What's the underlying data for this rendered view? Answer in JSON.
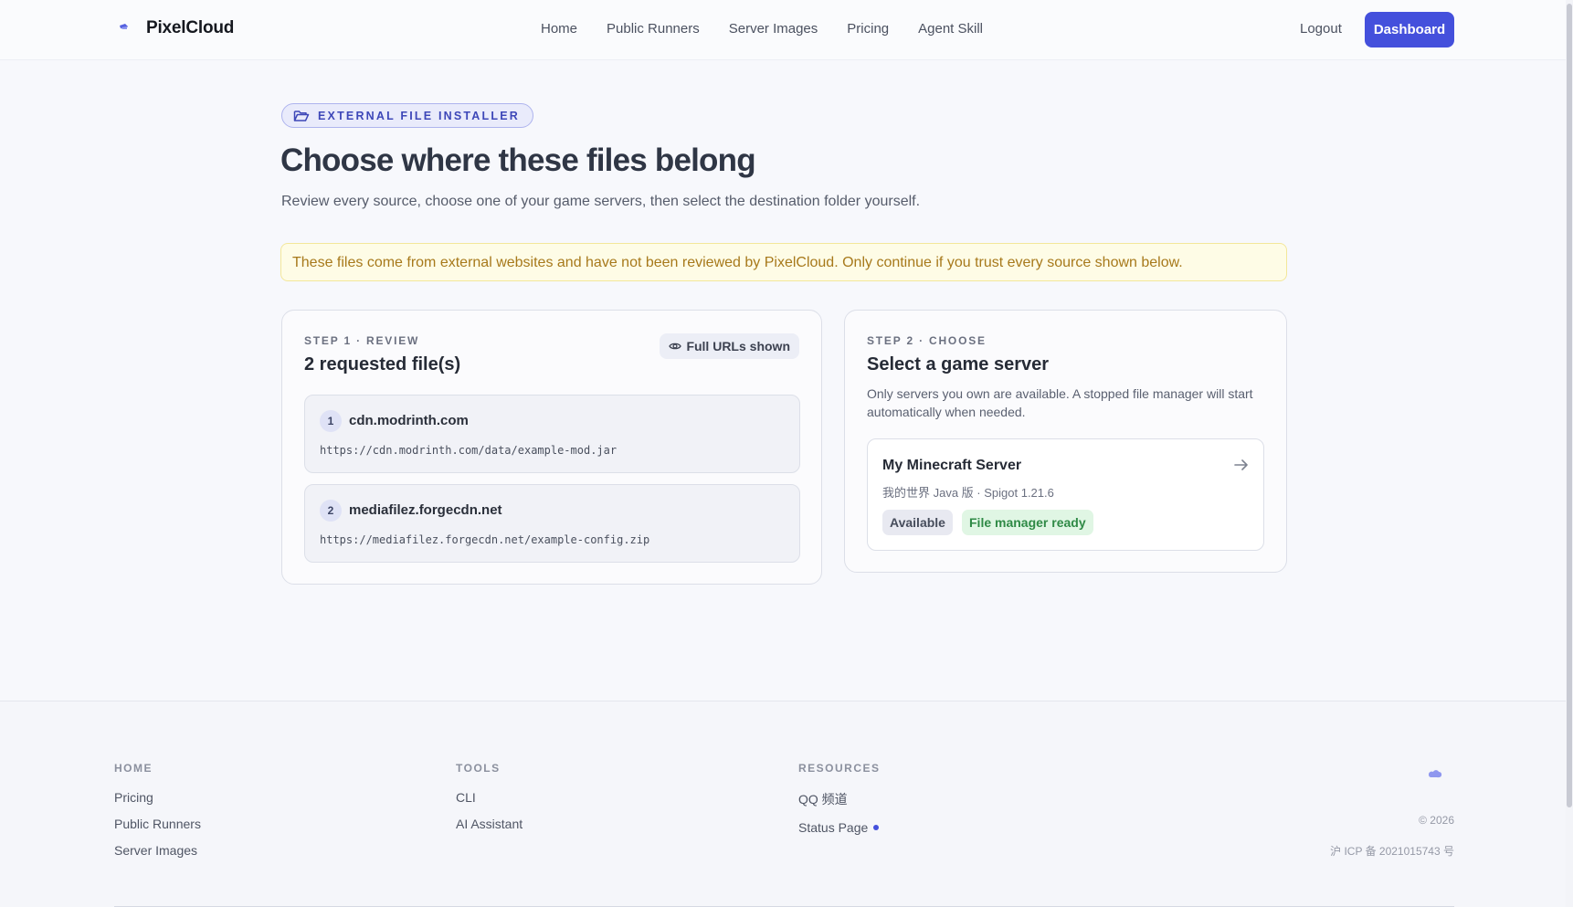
{
  "header": {
    "brand": "PixelCloud",
    "nav": [
      "Home",
      "Public Runners",
      "Server Images",
      "Pricing",
      "Agent Skill"
    ],
    "logout": "Logout",
    "dashboard": "Dashboard"
  },
  "main": {
    "badge": "EXTERNAL FILE INSTALLER",
    "title": "Choose where these files belong",
    "subtitle": "Review every source, choose one of your game servers, then select the destination folder yourself.",
    "warning": "These files come from external websites and have not been reviewed by PixelCloud. Only continue if you trust every source shown below."
  },
  "step1": {
    "label": "STEP 1 · REVIEW",
    "heading": "2 requested file(s)",
    "urls_chip": "Full URLs shown",
    "files": [
      {
        "num": "1",
        "host": "cdn.modrinth.com",
        "url": "https://cdn.modrinth.com/data/example-mod.jar"
      },
      {
        "num": "2",
        "host": "mediafilez.forgecdn.net",
        "url": "https://mediafilez.forgecdn.net/example-config.zip"
      }
    ]
  },
  "step2": {
    "label": "STEP 2 · CHOOSE",
    "heading": "Select a game server",
    "description": "Only servers you own are available. A stopped file manager will start automatically when needed.",
    "server": {
      "name": "My Minecraft Server",
      "meta": "我的世界 Java 版 · Spigot 1.21.6",
      "status": "Available",
      "file_manager": "File manager ready"
    }
  },
  "footer": {
    "col1": {
      "heading": "HOME",
      "links": [
        "Pricing",
        "Public Runners",
        "Server Images"
      ]
    },
    "col2": {
      "heading": "TOOLS",
      "links": [
        "CLI",
        "AI Assistant"
      ]
    },
    "col3": {
      "heading": "RESOURCES",
      "links": [
        "QQ 频道",
        "Status Page"
      ]
    },
    "copyright": "© 2026",
    "icp": "沪 ICP 备 2021015743 号"
  },
  "colors": {
    "accent": "#4450dc",
    "warning_bg": "#fefce6",
    "warning_text": "#a7791b",
    "success_bg": "#e0f6e4",
    "success_text": "#2f8a46"
  },
  "icons": [
    "cloud-logo-icon",
    "folder-open-icon",
    "eye-icon",
    "arrow-right-icon",
    "status-dot-icon"
  ]
}
